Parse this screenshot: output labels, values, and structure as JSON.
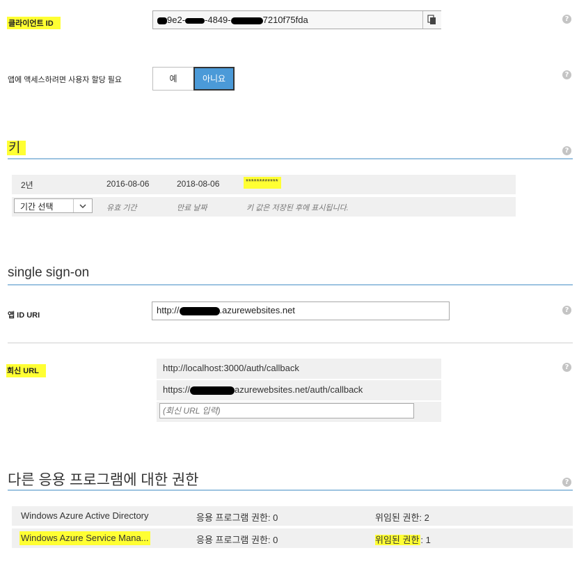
{
  "client_id": {
    "label": "클라이언트 ID",
    "value_prefix": "9e2-",
    "value_mid": "-4849-",
    "value_suffix": "7210f75fda",
    "copy_icon": "copy-icon"
  },
  "assignment": {
    "label": "앱에 액세스하려면 사용자 할당 필요",
    "yes_label": "예",
    "no_label": "아니요",
    "selected": "아니요"
  },
  "keys": {
    "title": "키",
    "rows": [
      {
        "duration": "2년",
        "valid_from": "2016-08-06",
        "expires": "2018-08-06",
        "value": "************"
      }
    ],
    "new_row": {
      "select_value": "기간 선택",
      "valid_placeholder": "유효 기간",
      "expire_placeholder": "만료 날짜",
      "value_placeholder": "키 값은 저장된 후에 표시됩니다."
    }
  },
  "sso": {
    "title": "single sign-on",
    "app_id_uri_label": "앱 ID URI",
    "app_id_uri_prefix": "http://",
    "app_id_uri_suffix": ".azurewebsites.net",
    "reply_url_label": "회신 URL",
    "reply_urls": [
      {
        "text": "http://localhost:3000/auth/callback"
      },
      {
        "prefix": "https://",
        "suffix": "azurewebsites.net/auth/callback"
      }
    ],
    "reply_url_placeholder": "(회신 URL 입력)"
  },
  "permissions": {
    "title": "다른 응용 프로그램에 대한 권한",
    "rows": [
      {
        "app": "Windows Azure Active Directory",
        "app_perm": "응용 프로그램 권한: 0",
        "delegated_label": "위임된 권한",
        "delegated_value": ": 2"
      },
      {
        "app": "Windows Azure Service Mana...",
        "app_perm": "응용 프로그램 권한: 0",
        "delegated_label": "위임된 권한",
        "delegated_value": ": 1"
      }
    ]
  },
  "help_icon": "?"
}
